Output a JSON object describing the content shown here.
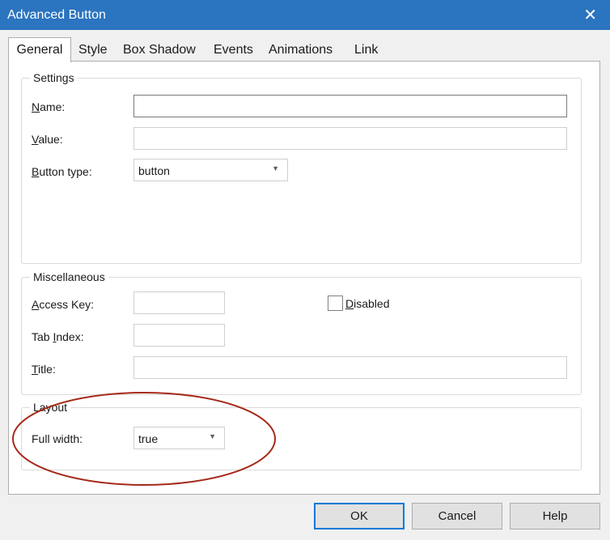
{
  "window": {
    "title": "Advanced Button",
    "close_glyph": "✕"
  },
  "tabs": [
    {
      "label": "General"
    },
    {
      "label": "Style"
    },
    {
      "label": "Box Shadow"
    },
    {
      "label": "Events"
    },
    {
      "label": "Animations"
    },
    {
      "label": "Link"
    }
  ],
  "settings": {
    "legend": "Settings",
    "name_label_u": "N",
    "name_label_rest": "ame:",
    "name_value": "",
    "value_label_u": "V",
    "value_label_rest": "alue:",
    "value_value": "",
    "button_type_label_u": "B",
    "button_type_label_rest": "utton type:",
    "button_type_value": "button"
  },
  "misc": {
    "legend": "Miscellaneous",
    "access_key_label_u": "A",
    "access_key_label_rest": "ccess Key:",
    "access_key_value": "",
    "tab_index_label_pre": "Tab ",
    "tab_index_label_u": "I",
    "tab_index_label_rest": "ndex:",
    "tab_index_value": "",
    "title_label_u": "T",
    "title_label_rest": "itle:",
    "title_value": "",
    "disabled_label_u": "D",
    "disabled_label_rest": "isabled",
    "disabled_checked": false
  },
  "layout": {
    "legend": "Layout",
    "full_width_label": "Full width:",
    "full_width_value": "true"
  },
  "buttons": {
    "ok": "OK",
    "cancel": "Cancel",
    "help": "Help"
  },
  "colors": {
    "titlebar": "#2b74bf",
    "highlight_circle": "#a52a1a",
    "default_button_border": "#0078d7"
  },
  "icons": {
    "close": "close-icon",
    "dropdown": "chevron-down-icon"
  }
}
